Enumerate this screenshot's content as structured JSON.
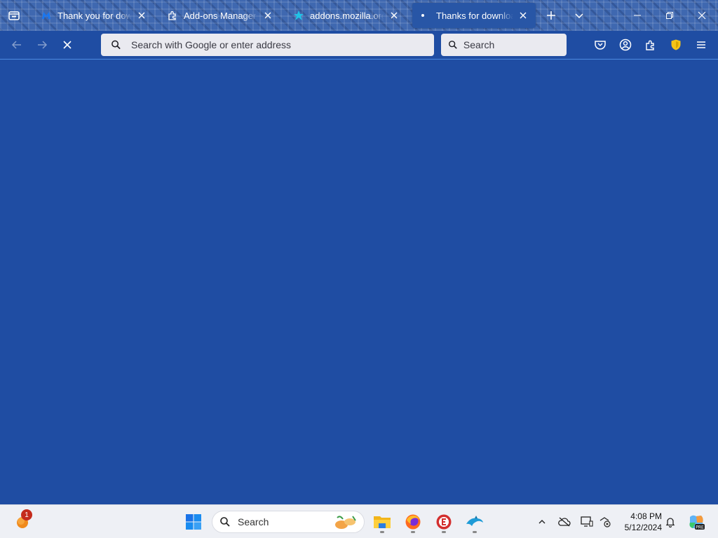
{
  "tabs": [
    {
      "title": "Thank you for downloading",
      "favicon": "malwarebytes-icon",
      "active": false
    },
    {
      "title": "Add-ons Manager",
      "favicon": "puzzle-piece-icon",
      "active": false
    },
    {
      "title": "addons.mozilla.org/en",
      "favicon": "cyan-star-icon",
      "active": false
    },
    {
      "title": "Thanks for downloading",
      "favicon": "loading-dot-icon",
      "active": true
    }
  ],
  "urlbar": {
    "placeholder": "Search with Google or enter address"
  },
  "searchbar": {
    "placeholder": "Search"
  },
  "taskbar": {
    "search_label": "Search",
    "notification_badge": "1",
    "clock_time": "4:08 PM",
    "clock_date": "5/12/2024"
  },
  "colors": {
    "accent": "#1f4da3",
    "tabstrip": "#3f68b0",
    "urlbar_bg": "#eaeaf0",
    "taskbar_bg": "#eef0f5"
  }
}
